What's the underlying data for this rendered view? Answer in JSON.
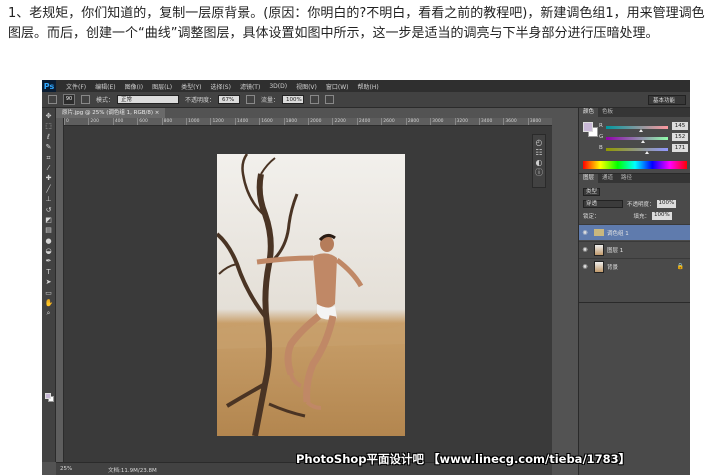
{
  "intro_text": "1、老规矩，你们知道的，复制一层原背景。(原因：你明白的?不明白，看看之前的教程吧)，新建调色组1，用来管理调色图层。而后，创建一个“曲线”调整图层，具体设置如图中所示，这一步是适当的调亮与下半身部分进行压暗处理。",
  "app": {
    "logo": "Ps",
    "menu": [
      "文件(F)",
      "编辑(E)",
      "图像(I)",
      "图层(L)",
      "类型(Y)",
      "选择(S)",
      "滤镜(T)",
      "3D(D)",
      "视图(V)",
      "窗口(W)",
      "帮助(H)"
    ]
  },
  "options_bar": {
    "brush_size": "90",
    "mode_label": "模式：",
    "mode_value": "正常",
    "opacity_label": "不透明度：",
    "opacity_value": "67%",
    "flow_label": "流量：",
    "flow_value": "100%",
    "preset": "基本功能"
  },
  "document": {
    "tab_title": "原片.jpg @ 25% (调色组 1, RGB/8) ×",
    "ruler_ticks": [
      "0",
      "200",
      "400",
      "600",
      "800",
      "1000",
      "1200",
      "1400",
      "1600",
      "1800",
      "2000",
      "2200",
      "2400",
      "2600",
      "2800",
      "3000",
      "3200",
      "3400",
      "3600",
      "3800"
    ]
  },
  "status": {
    "zoom": "25%",
    "doc_info": "文档:11.9M/23.8M"
  },
  "color_panel": {
    "tabs": [
      "颜色",
      "色板"
    ],
    "sliders": [
      {
        "label": "R",
        "value": "145",
        "track": "linear-gradient(90deg,#00989f,#ff989f)",
        "knob": 0.57
      },
      {
        "label": "G",
        "value": "152",
        "track": "linear-gradient(90deg,#9100ab,#91ffab)",
        "knob": 0.6
      },
      {
        "label": "B",
        "value": "171",
        "track": "linear-gradient(90deg,#919800,#9198ff)",
        "knob": 0.67
      }
    ]
  },
  "layers_panel": {
    "tabs": [
      "图层",
      "通道",
      "路径"
    ],
    "kind_label": "类型",
    "blend_mode": "穿透",
    "opacity_label": "不透明度：",
    "opacity_value": "100%",
    "lock_label": "锁定：",
    "fill_label": "填充：",
    "fill_value": "100%",
    "layers": [
      {
        "name": "调色组 1",
        "type": "group",
        "selected": true
      },
      {
        "name": "图层 1",
        "type": "image",
        "selected": false
      },
      {
        "name": "背景",
        "type": "image",
        "selected": false,
        "locked": true
      }
    ]
  },
  "watermark": "PhotoShop平面设计吧 【www.linecg.com/tieba/1783】",
  "icons": {
    "tools": [
      "move-icon",
      "marquee-icon",
      "lasso-icon",
      "quick-select-icon",
      "crop-icon",
      "eyedropper-icon",
      "healing-icon",
      "brush-icon",
      "stamp-icon",
      "history-brush-icon",
      "eraser-icon",
      "gradient-icon",
      "blur-icon",
      "dodge-icon",
      "pen-icon",
      "type-icon",
      "path-select-icon",
      "shape-icon",
      "hand-icon",
      "zoom-icon"
    ]
  }
}
